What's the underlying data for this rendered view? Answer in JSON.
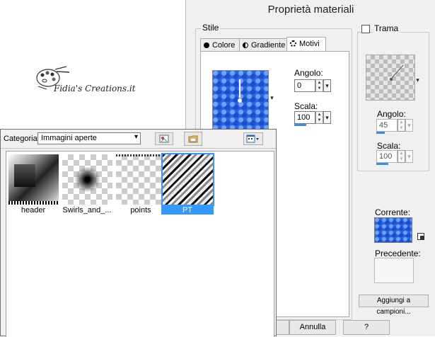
{
  "logo": {
    "text": "Fidia's Creations.it"
  },
  "dialog": {
    "title": "Proprietà materiali",
    "stile": {
      "label": "Stile",
      "tabs": [
        {
          "label": "Colore",
          "icon": "filled-circle-icon"
        },
        {
          "label": "Gradiente",
          "icon": "half-circle-icon"
        },
        {
          "label": "Motivi",
          "icon": "dotted-circle-icon",
          "active": true
        }
      ],
      "angolo": {
        "label": "Angolo:",
        "value": "0"
      },
      "scala": {
        "label": "Scala:",
        "value": "100"
      }
    },
    "trama": {
      "label": "Trama",
      "checked": false,
      "angolo": {
        "label": "Angolo:",
        "value": "45"
      },
      "scala": {
        "label": "Scala:",
        "value": "100"
      }
    },
    "corrente_label": "Corrente:",
    "precedente_label": "Precedente:",
    "aggiungi_label": "Aggiungi a campioni...",
    "annulla_label": "Annulla",
    "help_label": "?"
  },
  "popup": {
    "categoria_label": "Categoria:",
    "categoria_value": "Immagini aperte",
    "items": [
      {
        "label": "header",
        "selected": false
      },
      {
        "label": "Swirls_and_...",
        "selected": false
      },
      {
        "label": "points",
        "selected": false
      },
      {
        "label": "PT",
        "selected": true
      }
    ]
  },
  "colors": {
    "pattern_blue": "#2a63e0",
    "selection": "#3399ff",
    "dialog_bg": "#f0f0f0"
  }
}
